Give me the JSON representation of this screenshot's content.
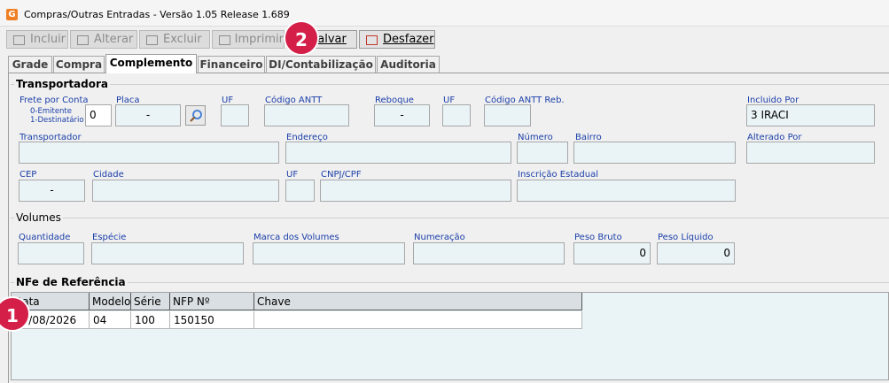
{
  "window": {
    "title": "Compras/Outras Entradas - Versão 1.05 Release 1.689",
    "icon_letter": "G"
  },
  "toolbar": {
    "incluir": "Incluir",
    "alterar": "Alterar",
    "excluir": "Excluir",
    "imprimir": "Imprimir",
    "salvar": "Salvar",
    "desfazer": "Desfazer"
  },
  "tabs": [
    "Grade",
    "Compra",
    "Complemento",
    "Financeiro",
    "DI/Contabilização",
    "Auditoria"
  ],
  "transportadora": {
    "group_title": "Transportadora",
    "frete_label": "Frete por Conta",
    "frete_opt0": "0-Emitente",
    "frete_opt1": "1-Destinatário",
    "frete_value": "0",
    "placa_label": "Placa",
    "placa_value": "-",
    "uf1_label": "UF",
    "antt_label": "Código ANTT",
    "reboque_label": "Reboque",
    "reboque_value": "-",
    "uf2_label": "UF",
    "antt_reb_label": "Código ANTT Reb.",
    "incluido_label": "Incluido Por",
    "incluido_value": "3 IRACI",
    "transportador_label": "Transportador",
    "endereco_label": "Endereço",
    "numero_label": "Número",
    "bairro_label": "Bairro",
    "alterado_label": "Alterado Por",
    "cep_label": "CEP",
    "cep_value": "-",
    "cidade_label": "Cidade",
    "uf3_label": "UF",
    "cnpj_label": "CNPJ/CPF",
    "ie_label": "Inscrição Estadual"
  },
  "volumes": {
    "group_title": "Volumes",
    "quantidade_label": "Quantidade",
    "especie_label": "Espécie",
    "marca_label": "Marca dos Volumes",
    "numeracao_label": "Numeração",
    "peso_bruto_label": "Peso Bruto",
    "peso_bruto_value": "0",
    "peso_liquido_label": "Peso Líquido",
    "peso_liquido_value": "0"
  },
  "nfe": {
    "group_title": "NFe de Referência",
    "columns": [
      "Data",
      "Modelo",
      "Série",
      "NFP Nº",
      "Chave"
    ],
    "rows": [
      [
        "10/08/2026",
        "04",
        "100",
        "150150",
        ""
      ]
    ]
  },
  "badges": {
    "one": "1",
    "two": "2"
  },
  "colors": {
    "label_blue": "#1a3ea8",
    "field_bg": "#eaf4f7",
    "badge": "#d41f49"
  }
}
